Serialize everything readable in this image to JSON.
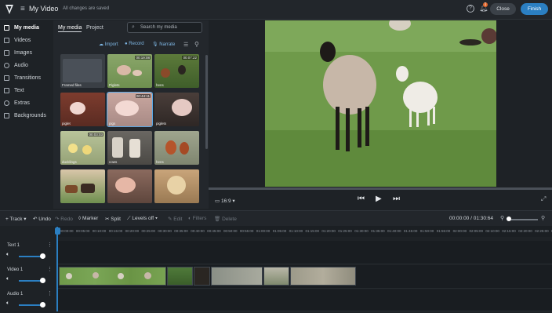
{
  "header": {
    "title": "My Video",
    "save_status": "All changes are saved",
    "help_label": "?",
    "notification_count": "1",
    "close_label": "Close",
    "finish_label": "Finish"
  },
  "sidebar": {
    "items": [
      {
        "label": "My media",
        "icon": "media-icon",
        "active": true
      },
      {
        "label": "Videos",
        "icon": "video-icon"
      },
      {
        "label": "Images",
        "icon": "image-icon"
      },
      {
        "label": "Audio",
        "icon": "audio-icon"
      },
      {
        "label": "Transitions",
        "icon": "transitions-icon"
      },
      {
        "label": "Text",
        "icon": "text-icon"
      },
      {
        "label": "Extras",
        "icon": "extras-icon"
      },
      {
        "label": "Backgrounds",
        "icon": "backgrounds-icon"
      }
    ]
  },
  "media_panel": {
    "tabs": [
      "My media",
      "Project"
    ],
    "search_placeholder": "Search my media",
    "actions": {
      "import": "Import",
      "record": "Record",
      "narrate": "Narrate"
    },
    "thumbnails": [
      {
        "caption": "Framed files",
        "duration": ""
      },
      {
        "caption": "Piglets",
        "duration": "00:19:08"
      },
      {
        "caption": "hens",
        "duration": "00:07:22"
      },
      {
        "caption": "piglet",
        "duration": ""
      },
      {
        "caption": "pigs",
        "duration": "00:44:11"
      },
      {
        "caption": "piglets",
        "duration": ""
      },
      {
        "caption": "ducklings",
        "duration": "00:03:03"
      },
      {
        "caption": "cows",
        "duration": ""
      },
      {
        "caption": "hens",
        "duration": ""
      },
      {
        "caption": "",
        "duration": ""
      },
      {
        "caption": "",
        "duration": ""
      },
      {
        "caption": "",
        "duration": ""
      }
    ]
  },
  "preview": {
    "aspect_ratio": "16:9"
  },
  "toolbar": {
    "track": "Track",
    "undo": "Undo",
    "redo": "Redo",
    "marker": "Marker",
    "split": "Split",
    "levels": "Levels off",
    "edit": "Edit",
    "filters": "Filters",
    "delete": "Delete",
    "timecode": "00:00:00 / 01:30:64"
  },
  "timeline": {
    "ticks": [
      "00:00:00",
      "00:05:00",
      "00:10:00",
      "00:15:00",
      "00:20:00",
      "00:25:00",
      "00:30:00",
      "00:35:00",
      "00:40:00",
      "00:45:00",
      "00:50:00",
      "00:55:00",
      "01:00:00",
      "01:05:00",
      "01:10:00",
      "01:15:00",
      "01:20:00",
      "01:25:00",
      "01:30:00",
      "01:35:00",
      "01:40:00",
      "01:45:00",
      "01:50:00",
      "01:55:00",
      "02:00:00",
      "02:05:00",
      "02:10:00",
      "02:15:00",
      "02:20:00",
      "02:25:00",
      "02:30:00"
    ],
    "tracks": [
      {
        "name": "Text 1",
        "volume": 0.9
      },
      {
        "name": "Video 1",
        "volume": 0.9
      },
      {
        "name": "Audio 1",
        "volume": 0.9
      }
    ]
  },
  "colors": {
    "accent": "#2b7fc2",
    "finish": "#2b7fc2",
    "notification": "#e0662c"
  }
}
